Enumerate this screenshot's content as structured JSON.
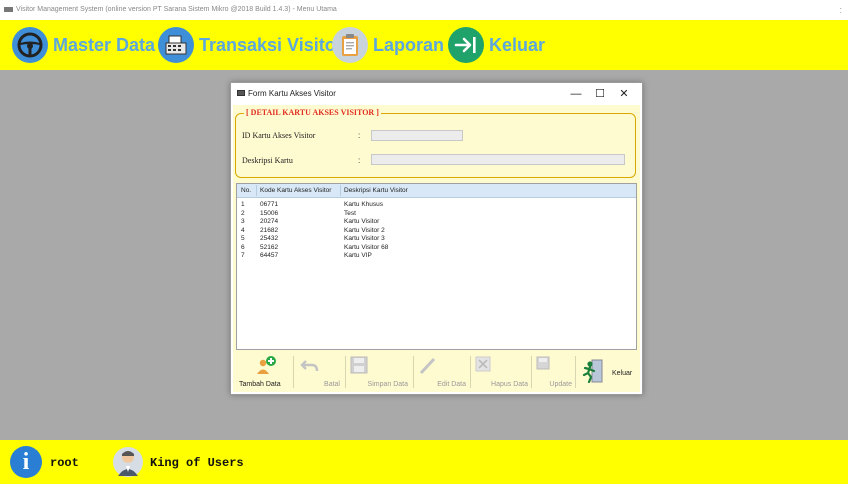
{
  "window": {
    "title": "Visitor Management System (online version PT Sarana Sistem Mikro @2018 Build 1.4.3) - Menu Utama"
  },
  "menu": [
    {
      "label": "Master Data",
      "icon": "steering-wheel-icon"
    },
    {
      "label": "Transaksi Visitor",
      "icon": "cash-register-icon"
    },
    {
      "label": "Laporan",
      "icon": "clipboard-icon"
    },
    {
      "label": "Keluar",
      "icon": "exit-arrow-icon"
    }
  ],
  "dialog": {
    "title": "Form Kartu Akses Visitor",
    "minimize": "—",
    "maximize": "☐",
    "close": "✕",
    "group_title": "[ DETAIL KARTU AKSES VISITOR ]",
    "fields": {
      "id_label": "ID Kartu Akses Visitor",
      "id_value": "",
      "desc_label": "Deskripsi Kartu",
      "desc_value": "",
      "colon": ":"
    },
    "table": {
      "columns": [
        "No.",
        "Kode Kartu Akses Visitor",
        "Deskripsi Kartu Visitor"
      ],
      "rows": [
        [
          "1",
          "06771",
          "Kartu Khusus"
        ],
        [
          "2",
          "15006",
          "Test"
        ],
        [
          "3",
          "20274",
          "Kartu Visitor"
        ],
        [
          "4",
          "21682",
          "Kartu Visitor 2"
        ],
        [
          "5",
          "25432",
          "Kartu Visitor 3"
        ],
        [
          "6",
          "52162",
          "Kartu Visitor 68"
        ],
        [
          "7",
          "64457",
          "Kartu VIP"
        ]
      ]
    },
    "toolbar": {
      "tambah": "Tambah Data",
      "batal": "Batal",
      "simpan": "Simpan Data",
      "edit": "Edit Data",
      "hapus": "Hapus Data",
      "update": "Update",
      "keluar": "Keluar"
    }
  },
  "status": {
    "user": "root",
    "role": "King of Users"
  },
  "colors": {
    "bar": "#ffff00",
    "menu_text": "#5ca7dd",
    "icon_blue": "#3f8fd8",
    "group_border": "#d8a800",
    "group_title": "#e03020",
    "form_bg": "#fffbd1",
    "workspace": "#a9a9a9"
  }
}
